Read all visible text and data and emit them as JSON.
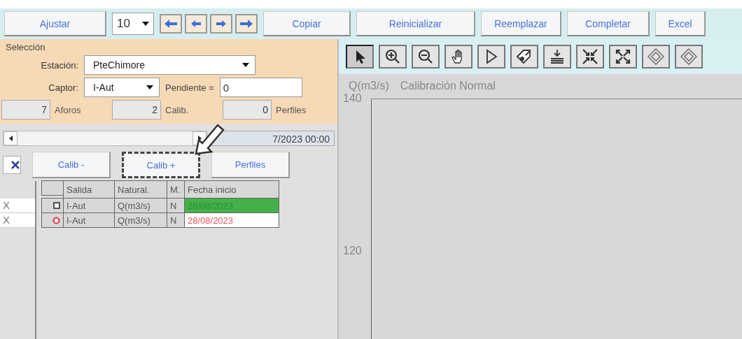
{
  "toolbar": {
    "buttons": [
      {
        "label": "Ajustar"
      },
      {
        "label": "Copiar"
      },
      {
        "label": "Reinicializar"
      },
      {
        "label": "Reemplazar"
      },
      {
        "label": "Completar"
      },
      {
        "label": "Excel"
      }
    ],
    "count_combo": {
      "value": "10"
    },
    "nav_buttons": [
      {
        "kind": "first"
      },
      {
        "kind": "prev"
      },
      {
        "kind": "next"
      },
      {
        "kind": "last"
      }
    ]
  },
  "selection": {
    "title": "Selección",
    "station_label": "Estación:",
    "station": "PteChimore",
    "sensor_label": "Captor:",
    "sensor": "I-Aut",
    "slope_label": "Pendiente =",
    "slope": "0",
    "counters": [
      {
        "value": "7",
        "label": "Aforos"
      },
      {
        "value": "2",
        "label": "Calib."
      },
      {
        "value": "0",
        "label": "Perfiles"
      }
    ]
  },
  "date_field": {
    "value": "7/2023 00:00"
  },
  "actions": {
    "checkbox_checked": true,
    "buttons": [
      {
        "label": "Calib -",
        "highlighted": false
      },
      {
        "label": "Calib +",
        "highlighted": true
      },
      {
        "label": "Perfiles",
        "highlighted": false
      }
    ]
  },
  "table": {
    "columns": [
      "Salida",
      "Natural.",
      "M.",
      "Fecha inicio"
    ],
    "rows": [
      {
        "row_header": "X",
        "kind": "square",
        "salida": "I-Aut",
        "natural": "Q(m3/s)",
        "m": "N",
        "fecha": "28/08/2023",
        "highlighted": true
      },
      {
        "row_header": "X",
        "kind": "circle",
        "salida": "I-Aut",
        "natural": "Q(m3/s)",
        "m": "N",
        "fecha": "28/08/2023",
        "highlighted": false
      }
    ]
  },
  "chart": {
    "tools": [
      {
        "kind": "pointer",
        "selected": true
      },
      {
        "kind": "zoom-in",
        "selected": false
      },
      {
        "kind": "zoom-out",
        "selected": false
      },
      {
        "kind": "hand",
        "selected": false
      },
      {
        "kind": "select",
        "selected": false
      },
      {
        "kind": "tag",
        "selected": false
      },
      {
        "kind": "stack",
        "selected": false
      },
      {
        "kind": "shrink",
        "selected": false
      },
      {
        "kind": "expand",
        "selected": false
      },
      {
        "kind": "diamond",
        "selected": false
      },
      {
        "kind": "diamond",
        "selected": false
      }
    ],
    "unit": "Q(m3/s)",
    "title": "Calibración Normal",
    "y_ticks": [
      "140",
      "120"
    ]
  }
}
